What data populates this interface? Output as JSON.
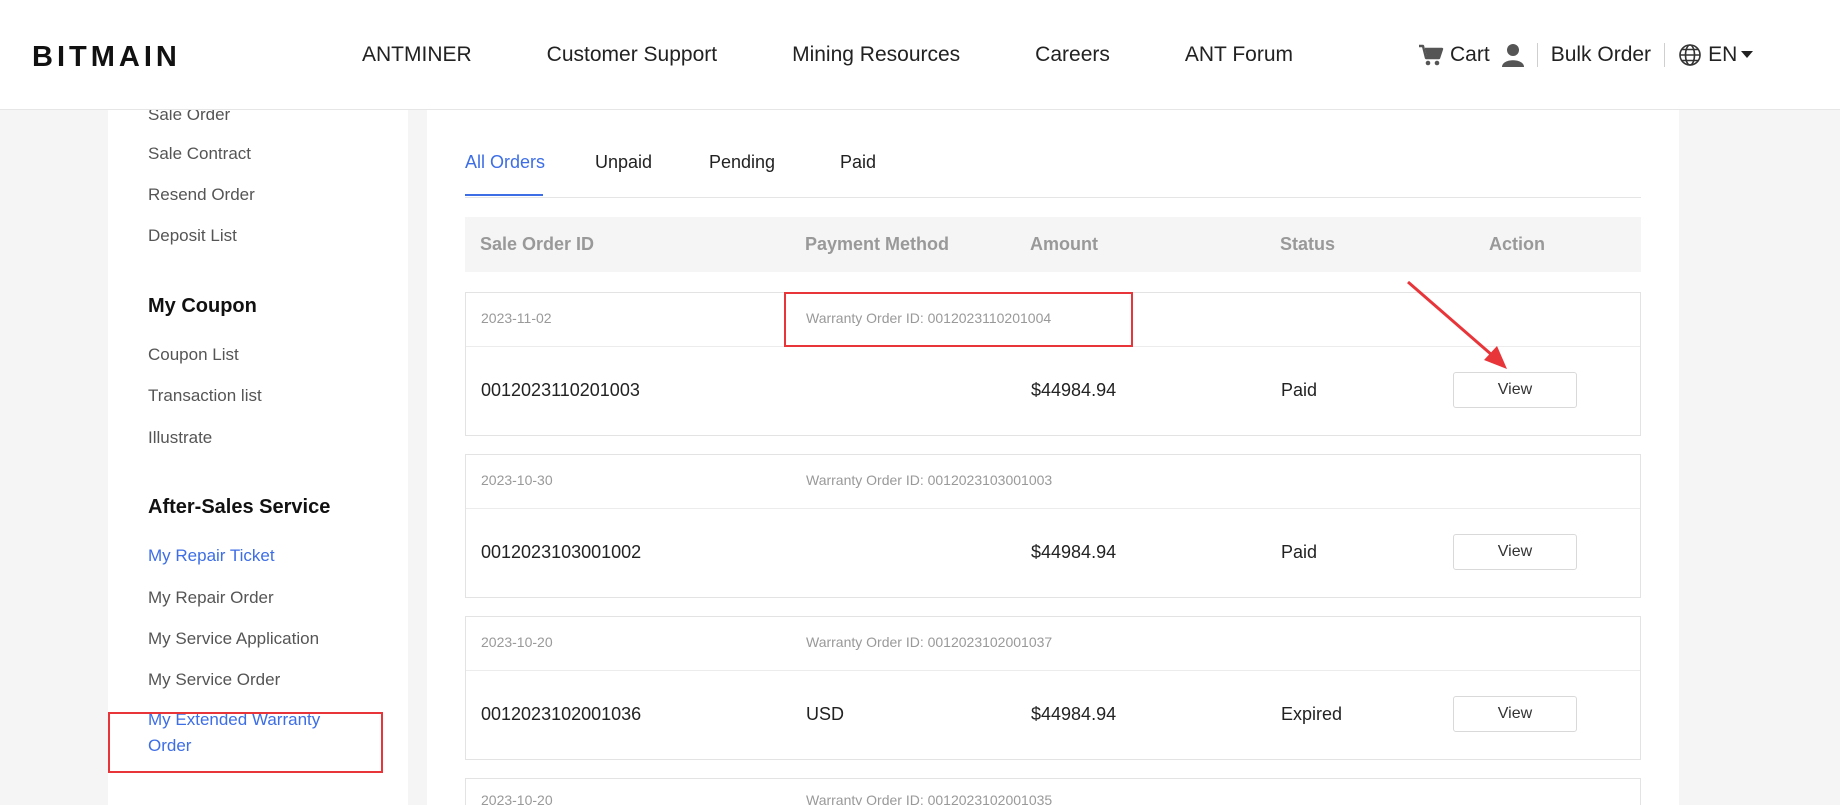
{
  "header": {
    "logo_text": "BITMAIN",
    "nav": [
      "ANTMINER",
      "Customer Support",
      "Mining Resources",
      "Careers",
      "ANT Forum"
    ],
    "cart_label": "Cart",
    "bulk_order_label": "Bulk Order",
    "language": "EN",
    "icons": [
      "cart-icon",
      "user-icon",
      "globe-icon",
      "caret-down-icon"
    ]
  },
  "sidebar": {
    "orders_links": [
      "Sale Order",
      "Sale Contract",
      "Resend Order",
      "Deposit List"
    ],
    "coupon_title": "My Coupon",
    "coupon_links": [
      "Coupon List",
      "Transaction list",
      "Illustrate"
    ],
    "after_sales_title": "After-Sales Service",
    "after_sales_links": [
      "My Repair Ticket",
      "My Repair Order",
      "My Service Application",
      "My Service Order",
      "My Extended Warranty Order"
    ]
  },
  "tabs": [
    "All Orders",
    "Unpaid",
    "Pending",
    "Paid"
  ],
  "active_tab": "All Orders",
  "table": {
    "columns": [
      "Sale Order ID",
      "Payment Method",
      "Amount",
      "Status",
      "Action"
    ],
    "rows": [
      {
        "date": "2023-11-02",
        "warranty": "Warranty Order ID: 0012023110201004",
        "id": "0012023110201003",
        "payment": "",
        "amount": "$44984.94",
        "status": "Paid",
        "action": "View"
      },
      {
        "date": "2023-10-30",
        "warranty": "Warranty Order ID: 0012023103001003",
        "id": "0012023103001002",
        "payment": "",
        "amount": "$44984.94",
        "status": "Paid",
        "action": "View"
      },
      {
        "date": "2023-10-20",
        "warranty": "Warranty Order ID: 0012023102001037",
        "id": "0012023102001036",
        "payment": "USD",
        "amount": "$44984.94",
        "status": "Expired",
        "action": "View"
      },
      {
        "date": "2023-10-20",
        "warranty": "Warranty Order ID: 0012023102001035"
      }
    ]
  },
  "colors": {
    "accent": "#3d6ee5",
    "annotation": "#e8353a"
  }
}
